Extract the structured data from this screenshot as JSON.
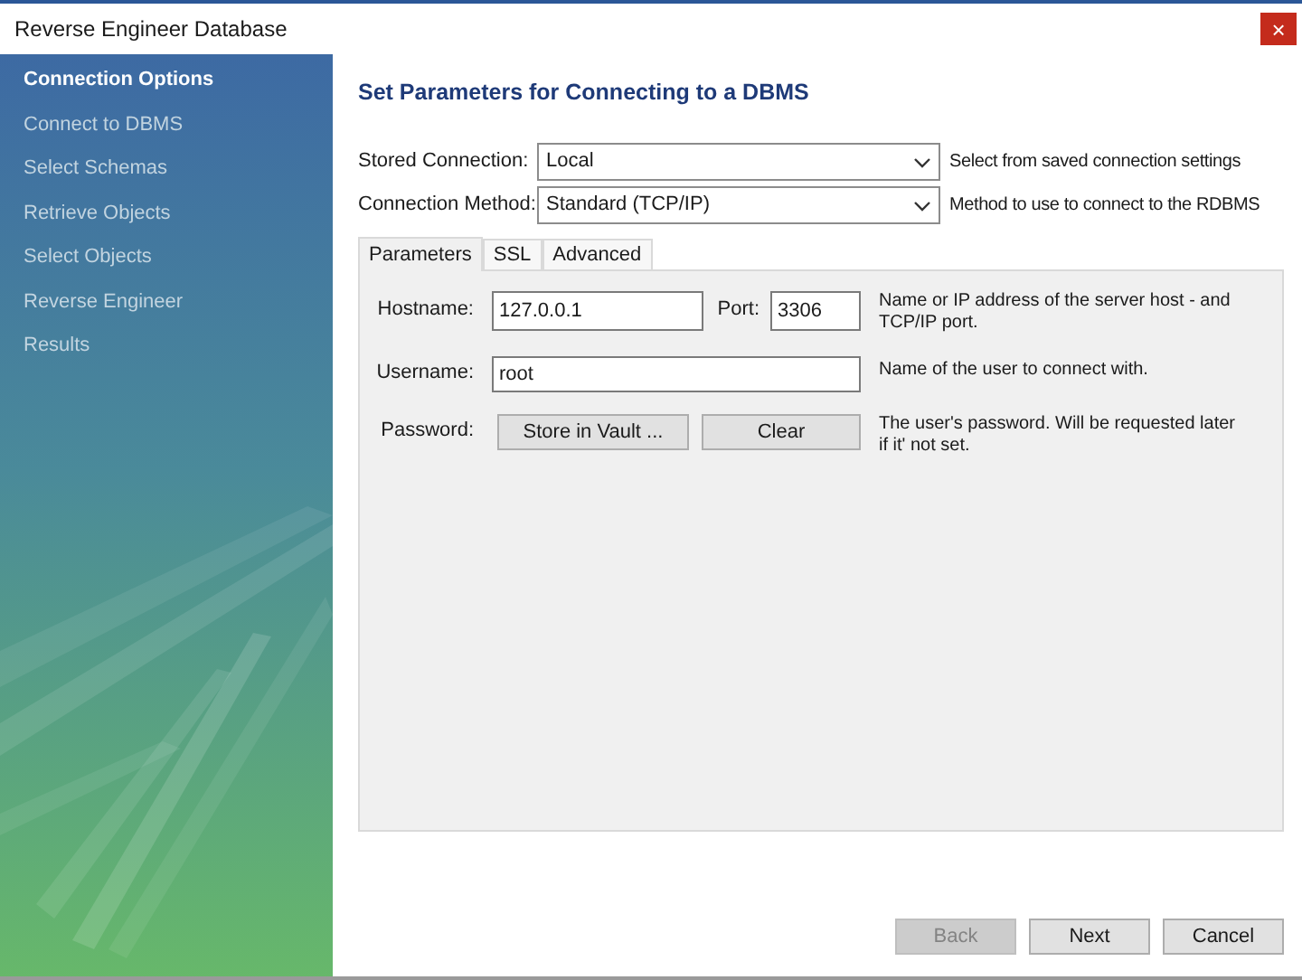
{
  "window": {
    "title": "Reverse Engineer Database",
    "close": "×"
  },
  "steps": [
    {
      "label": "Connection Options",
      "selected": true
    },
    {
      "label": "Connect to DBMS",
      "selected": false
    },
    {
      "label": "Select Schemas",
      "selected": false
    },
    {
      "label": "Retrieve Objects",
      "selected": false
    },
    {
      "label": "Select Objects",
      "selected": false
    },
    {
      "label": "Reverse Engineer",
      "selected": false
    },
    {
      "label": "Results",
      "selected": false
    }
  ],
  "heading": "Set Parameters for Connecting to a DBMS",
  "selects": [
    {
      "label": "Stored Connection:",
      "value": "Local",
      "help": "Select from saved connection settings"
    },
    {
      "label": "Connection Method:",
      "value": "Standard (TCP/IP)",
      "help": "Method to use to connect to the RDBMS"
    }
  ],
  "tabs": [
    {
      "label": "Parameters",
      "selected": true
    },
    {
      "label": "SSL",
      "selected": false
    },
    {
      "label": "Advanced",
      "selected": false
    }
  ],
  "parameters": {
    "hostname": {
      "label": "Hostname:",
      "value": "127.0.0.1"
    },
    "port": {
      "label": "Port:",
      "value": "3306"
    },
    "host_help": "Name or IP address of the server host - and TCP/IP port.",
    "username": {
      "label": "Username:",
      "value": "root",
      "help": "Name of the user to connect with."
    },
    "password": {
      "label": "Password:",
      "buttons": [
        "Store in Vault ...",
        "Clear"
      ],
      "help": "The user's password. Will be requested later if it' not set."
    }
  },
  "buttons": [
    {
      "label": "Back",
      "disabled": true
    },
    {
      "label": "Next",
      "disabled": false
    },
    {
      "label": "Cancel",
      "disabled": false
    }
  ]
}
